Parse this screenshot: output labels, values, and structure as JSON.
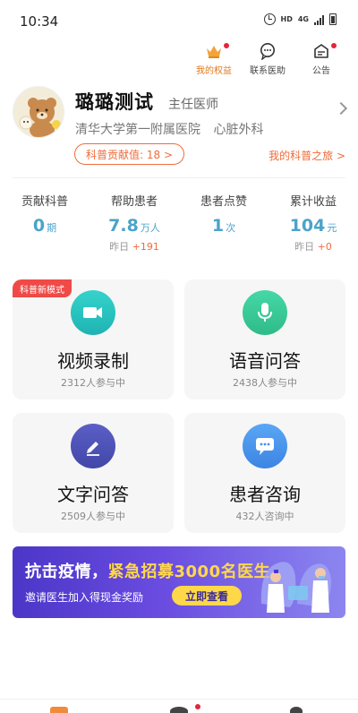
{
  "status_bar": {
    "time": "10:34",
    "hd": "HD",
    "network": "4G"
  },
  "top_actions": [
    {
      "label": "我的权益",
      "icon": "crown-icon",
      "active": true,
      "dot": true
    },
    {
      "label": "联系医助",
      "icon": "chat-icon",
      "active": false,
      "dot": false
    },
    {
      "label": "公告",
      "icon": "notice-icon",
      "active": false,
      "dot": true
    }
  ],
  "profile": {
    "name": "璐璐测试",
    "title": "主任医师",
    "hospital": "清华大学第一附属医院",
    "department": "心脏外科",
    "contribution": "科普贡献值: 18 >",
    "journey_link": "我的科普之旅 >"
  },
  "stats": [
    {
      "label": "贡献科普",
      "value": "0",
      "unit": "期",
      "delta_label": "",
      "delta": ""
    },
    {
      "label": "帮助患者",
      "value": "7.8",
      "unit": "万人",
      "delta_label": "昨日",
      "delta": "+191"
    },
    {
      "label": "患者点赞",
      "value": "1",
      "unit": "次",
      "delta_label": "",
      "delta": ""
    },
    {
      "label": "累计收益",
      "value": "104",
      "unit": "元",
      "delta_label": "昨日",
      "delta": "+0"
    }
  ],
  "cards": {
    "video": {
      "badge": "科普新模式",
      "title": "视频录制",
      "sub": "2312人参与中",
      "icon": "video-camera-icon"
    },
    "voice": {
      "title": "语音问答",
      "sub": "2438人参与中",
      "icon": "microphone-icon"
    },
    "text": {
      "title": "文字问答",
      "sub": "2509人参与中",
      "icon": "pencil-icon"
    },
    "consult": {
      "title": "患者咨询",
      "sub": "432人咨询中",
      "icon": "chat-bubble-icon"
    }
  },
  "banner": {
    "title_part1": "抗击疫情，",
    "title_part2": "紧急招募3000名医生",
    "subtitle": "邀请医生加入得现金奖励",
    "button": "立即查看"
  },
  "colors": {
    "accent": "#ef6c3b",
    "stat_blue": "#4ba3c9",
    "badge_red": "#ef4a47"
  }
}
